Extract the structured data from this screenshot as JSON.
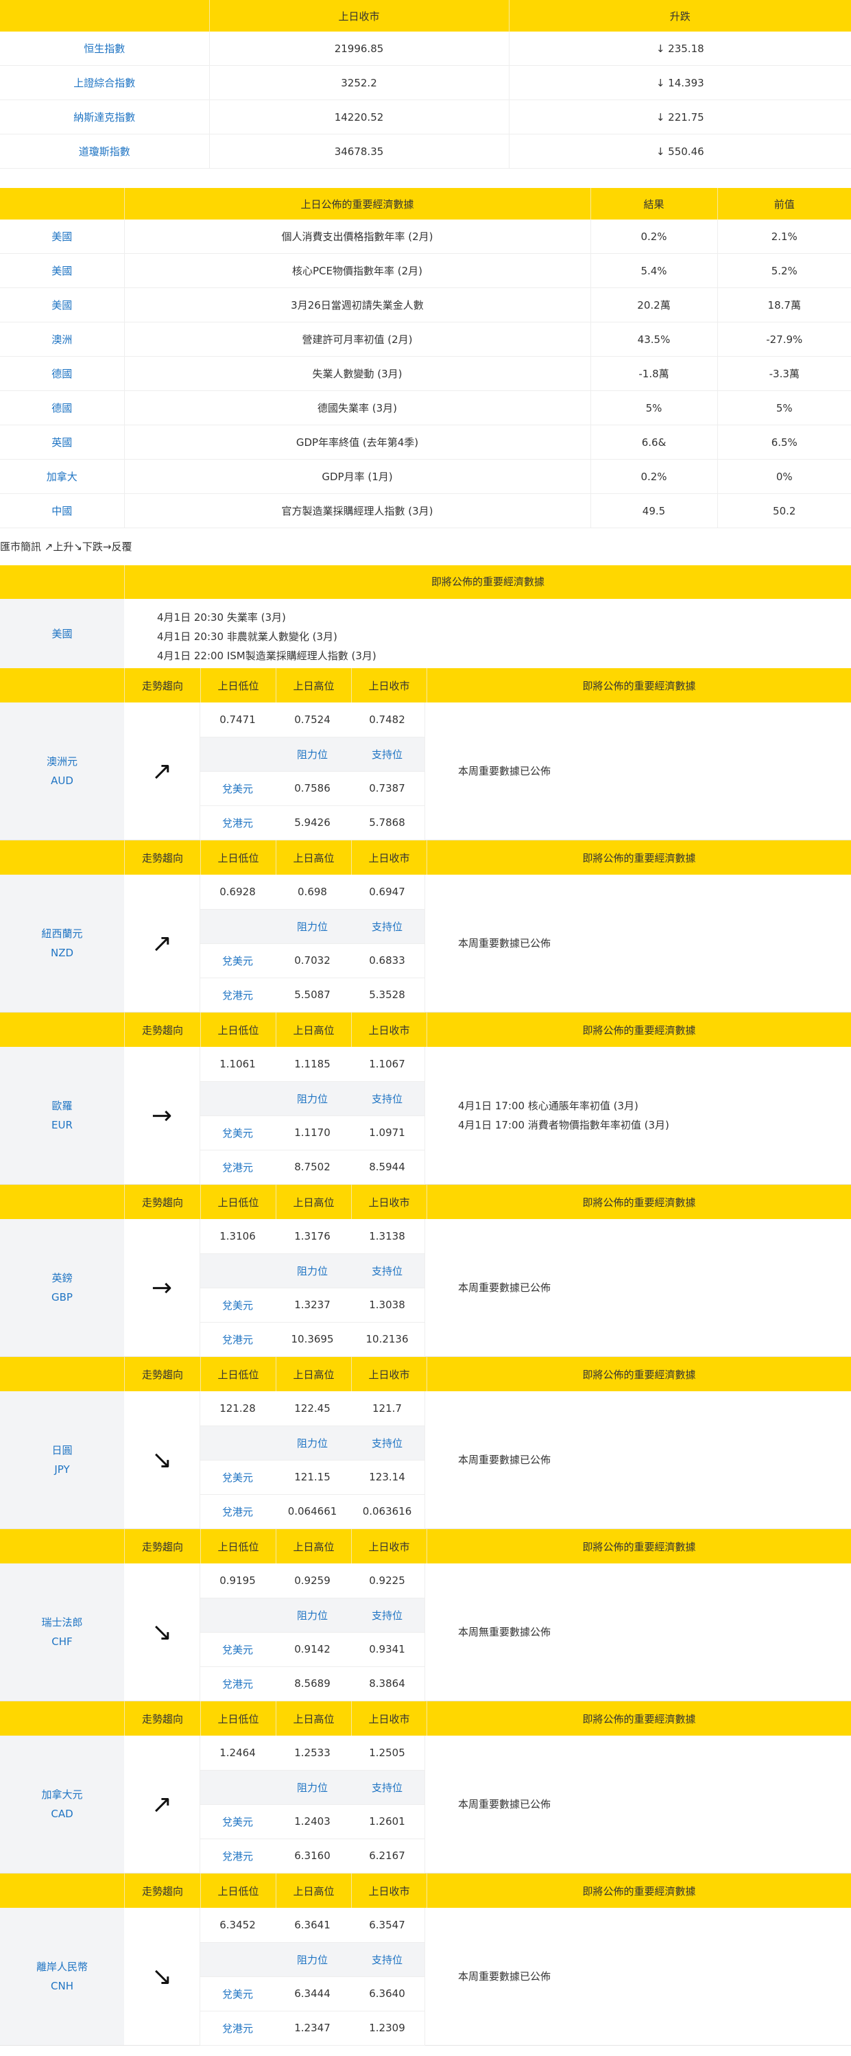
{
  "indices": {
    "headers": [
      "",
      "上日收市",
      "升跌"
    ],
    "rows": [
      {
        "name": "恒生指數",
        "close": "21996.85",
        "change": "↓  235.18"
      },
      {
        "name": "上證綜合指數",
        "close": "3252.2",
        "change": "↓  14.393"
      },
      {
        "name": "納斯達克指數",
        "close": "14220.52",
        "change": "↓  221.75"
      },
      {
        "name": "道瓊斯指數",
        "close": "34678.35",
        "change": "↓  550.46"
      }
    ]
  },
  "indicators": {
    "headers": [
      "",
      "上日公佈的重要經濟數據",
      "結果",
      "前值"
    ],
    "rows": [
      {
        "country": "美國",
        "item": "個人消費支出價格指數年率 (2月)",
        "result": "0.2%",
        "previous": "2.1%"
      },
      {
        "country": "美國",
        "item": "核心PCE物價指數年率 (2月)",
        "result": "5.4%",
        "previous": "5.2%"
      },
      {
        "country": "美國",
        "item": "3月26日當週初請失業金人數",
        "result": "20.2萬",
        "previous": "18.7萬"
      },
      {
        "country": "澳洲",
        "item": "營建許可月率初值 (2月)",
        "result": "43.5%",
        "previous": "-27.9%"
      },
      {
        "country": "德國",
        "item": "失業人數變動 (3月)",
        "result": "-1.8萬",
        "previous": "-3.3萬"
      },
      {
        "country": "德國",
        "item": "德國失業率 (3月)",
        "result": "5%",
        "previous": "5%"
      },
      {
        "country": "英國",
        "item": "GDP年率終值 (去年第4季)",
        "result": "6.6&",
        "previous": "6.5%"
      },
      {
        "country": "加拿大",
        "item": "GDP月率 (1月)",
        "result": "0.2%",
        "previous": "0%"
      },
      {
        "country": "中國",
        "item": "官方製造業採購經理人指數 (3月)",
        "result": "49.5",
        "previous": "50.2"
      }
    ]
  },
  "legend": "匯市簡訊 ↗上升↘下跌→反覆",
  "upcoming": {
    "header": "即將公佈的重要經濟數據",
    "country": "美國",
    "events": [
      "4月1日 20:30 失業率 (3月)",
      "4月1日 20:30 非農就業人數變化 (3月)",
      "4月1日 22:00 ISM製造業採購經理人指數 (3月)"
    ]
  },
  "currency_headers": {
    "trend": "走勢趨向",
    "low": "上日低位",
    "high": "上日高位",
    "close": "上日收市",
    "resistance": "阻力位",
    "support": "支持位",
    "news": "即將公佈的重要經濟數據"
  },
  "currencies": [
    {
      "name": "澳洲元",
      "code": "AUD",
      "arrow": "↗",
      "low": "0.7471",
      "high": "0.7524",
      "close": "0.7482",
      "r1_label": "兌美元",
      "r1_res": "0.7586",
      "r1_sup": "0.7387",
      "r2_label": "兌港元",
      "r2_res": "5.9426",
      "r2_sup": "5.7868",
      "news": [
        "本周重要數據已公佈"
      ]
    },
    {
      "name": "紐西蘭元",
      "code": "NZD",
      "arrow": "↗",
      "low": "0.6928",
      "high": "0.698",
      "close": "0.6947",
      "r1_label": "兌美元",
      "r1_res": "0.7032",
      "r1_sup": "0.6833",
      "r2_label": "兌港元",
      "r2_res": "5.5087",
      "r2_sup": "5.3528",
      "news": [
        "本周重要數據已公佈"
      ]
    },
    {
      "name": "歐羅",
      "code": "EUR",
      "arrow": "→",
      "low": "1.1061",
      "high": "1.1185",
      "close": "1.1067",
      "r1_label": "兌美元",
      "r1_res": "1.1170",
      "r1_sup": "1.0971",
      "r2_label": "兌港元",
      "r2_res": "8.7502",
      "r2_sup": "8.5944",
      "news": [
        "4月1日 17:00 核心通脹年率初值 (3月)",
        "4月1日 17:00 消費者物價指數年率初值 (3月)"
      ]
    },
    {
      "name": "英鎊",
      "code": "GBP",
      "arrow": "→",
      "low": "1.3106",
      "high": "1.3176",
      "close": "1.3138",
      "r1_label": "兌美元",
      "r1_res": "1.3237",
      "r1_sup": "1.3038",
      "r2_label": "兌港元",
      "r2_res": "10.3695",
      "r2_sup": "10.2136",
      "news": [
        "本周重要數據已公佈"
      ]
    },
    {
      "name": "日圓",
      "code": "JPY",
      "arrow": "↘",
      "low": "121.28",
      "high": "122.45",
      "close": "121.7",
      "r1_label": "兌美元",
      "r1_res": "121.15",
      "r1_sup": "123.14",
      "r2_label": "兌港元",
      "r2_res": "0.064661",
      "r2_sup": "0.063616",
      "news": [
        "本周重要數據已公佈"
      ]
    },
    {
      "name": "瑞士法郎",
      "code": "CHF",
      "arrow": "↘",
      "low": "0.9195",
      "high": "0.9259",
      "close": "0.9225",
      "r1_label": "兌美元",
      "r1_res": "0.9142",
      "r1_sup": "0.9341",
      "r2_label": "兌港元",
      "r2_res": "8.5689",
      "r2_sup": "8.3864",
      "news": [
        "本周無重要數據公佈"
      ]
    },
    {
      "name": "加拿大元",
      "code": "CAD",
      "arrow": "↗",
      "low": "1.2464",
      "high": "1.2533",
      "close": "1.2505",
      "r1_label": "兌美元",
      "r1_res": "1.2403",
      "r1_sup": "1.2601",
      "r2_label": "兌港元",
      "r2_res": "6.3160",
      "r2_sup": "6.2167",
      "news": [
        "本周重要數據已公佈"
      ]
    },
    {
      "name": "離岸人民幣",
      "code": "CNH",
      "arrow": "↘",
      "low": "6.3452",
      "high": "6.3641",
      "close": "6.3547",
      "r1_label": "兌美元",
      "r1_res": "6.3444",
      "r1_sup": "6.3640",
      "r2_label": "兌港元",
      "r2_res": "1.2347",
      "r2_sup": "1.2309",
      "news": [
        "本周重要數據已公佈"
      ]
    }
  ]
}
